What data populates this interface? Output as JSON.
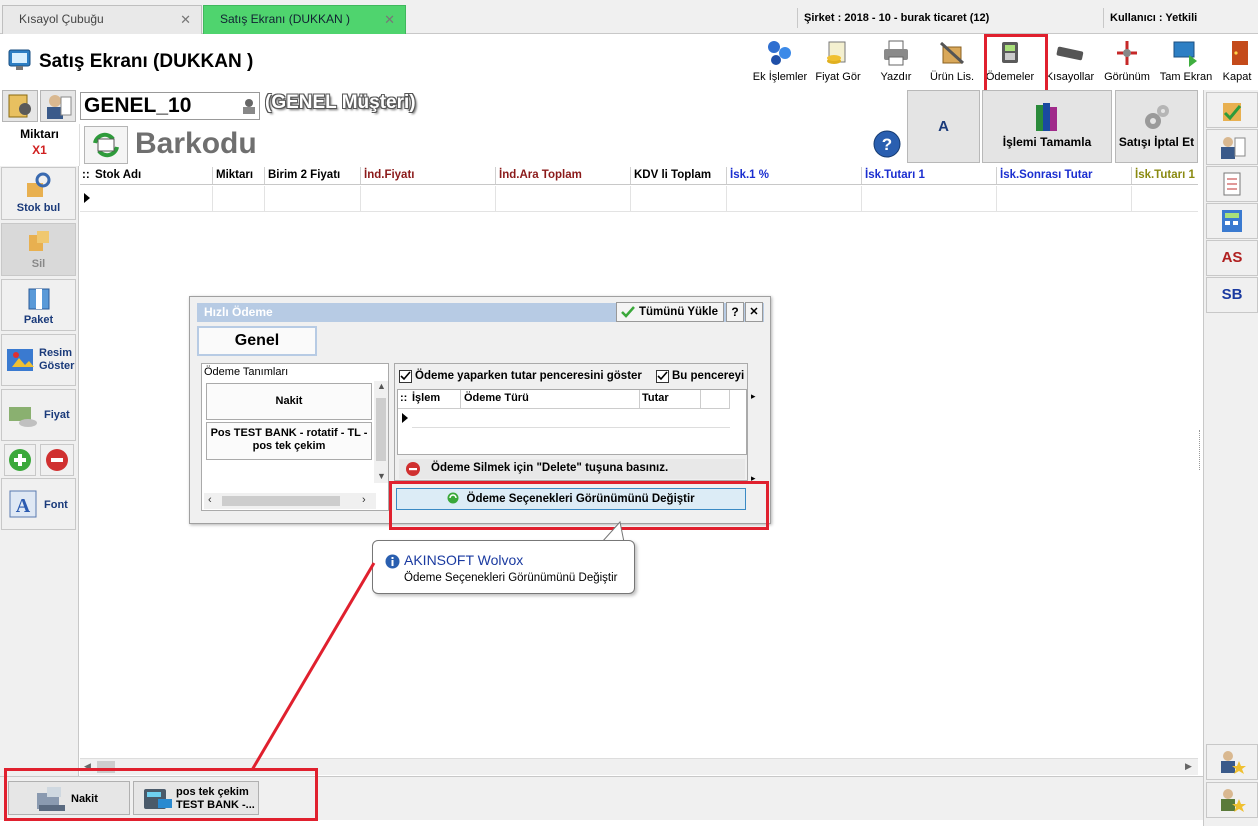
{
  "tabs": [
    {
      "label": "Kısayol Çubuğu",
      "close": "✕"
    },
    {
      "label": "Satış Ekranı (DUKKAN )",
      "close": "✕"
    }
  ],
  "header_info": {
    "company": "Şirket : 2018 - 10 - burak ticaret (12)",
    "user": "Kullanıcı : Yetkili"
  },
  "page_title": "Satış Ekranı (DUKKAN )",
  "toolbar": [
    {
      "label": "Ek İşlemler",
      "icon": "extra-operations-icon"
    },
    {
      "label": "Fiyat Gör",
      "icon": "price-view-icon"
    },
    {
      "label": "Yazdır",
      "icon": "printer-icon"
    },
    {
      "label": "Ürün Lis.",
      "icon": "product-list-icon"
    },
    {
      "label": "Ödemeler",
      "icon": "payments-icon"
    },
    {
      "label": "Kısayollar",
      "icon": "shortcuts-icon"
    },
    {
      "label": "Görünüm",
      "icon": "view-icon"
    },
    {
      "label": "Tam Ekran",
      "icon": "fullscreen-icon"
    },
    {
      "label": "Kapat",
      "icon": "close-door-icon"
    }
  ],
  "customer": {
    "code": "GENEL_10",
    "name": "(GENEL Müşteri)"
  },
  "quantity": {
    "label": "Miktarı",
    "value": "X1"
  },
  "barcode_label": "Barkodu",
  "right_buttons": {
    "a_label": "A",
    "complete_label": "İşlemi Tamamla",
    "cancel_label": "Satışı İptal Et"
  },
  "left_panel": [
    {
      "label": "Stok bul",
      "icon": "stock-search-icon"
    },
    {
      "label": "Sil",
      "icon": "delete-icon"
    },
    {
      "label": "Paket",
      "icon": "package-icon"
    },
    {
      "label": "Resim Göster",
      "icon": "picture-icon"
    },
    {
      "label": "Fiyat",
      "icon": "price-icon"
    },
    {
      "label": "Font",
      "icon": "font-icon"
    }
  ],
  "grid": {
    "row_marker": "::",
    "columns": [
      {
        "label": "Stok Adı",
        "color": "#000000"
      },
      {
        "label": "Miktarı",
        "color": "#000000"
      },
      {
        "label": "Birim 2 Fiyatı",
        "color": "#000000"
      },
      {
        "label": "İnd.Fiyatı",
        "color": "#8b1a1a"
      },
      {
        "label": "İnd.Ara Toplam",
        "color": "#8b1a1a"
      },
      {
        "label": "KDV li Toplam",
        "color": "#000000"
      },
      {
        "label": "İsk.1 %",
        "color": "#1a2ed0"
      },
      {
        "label": "İsk.Tutarı 1",
        "color": "#1a2ed0"
      },
      {
        "label": "İsk.Sonrası Tutar",
        "color": "#1a2ed0"
      },
      {
        "label": "İsk.Tutarı 1",
        "color": "#8a8a10"
      }
    ]
  },
  "right_panel": {
    "as_label": "AS",
    "sb_label": "SB"
  },
  "dialog": {
    "title": "Hızlı Ödeme",
    "load_all": "Tümünü Yükle",
    "help": "?",
    "close": "✕",
    "tab_general": "Genel",
    "payment_defs_header": "Ödeme Tanımları",
    "payment_defs": [
      "Nakit",
      "Pos TEST BANK - rotatif - TL - pos tek çekim"
    ],
    "checkbox_show_amount": "Ödeme yaparken tutar penceresini göster",
    "checkbox_this_window": "Bu pencereyi",
    "table_headers": [
      "İşlem",
      "Ödeme Türü",
      "Tutar"
    ],
    "delete_hint": "Ödeme Silmek için \"Delete\" tuşuna basınız.",
    "change_view_button": "Ödeme Seçenekleri Görünümünü Değiştir"
  },
  "tooltip": {
    "title": "AKINSOFT Wolvox",
    "text": "Ödeme Seçenekleri Görünümünü Değiştir"
  },
  "bottom_payments": [
    {
      "label": "Nakit"
    },
    {
      "label_line1": "pos tek çekim",
      "label_line2": "TEST BANK -..."
    }
  ],
  "colors": {
    "active_tab": "#4fd46e",
    "highlight": "#e0202e",
    "title_bar": "#b7cbe4",
    "link_blue": "#1a3a7a"
  }
}
